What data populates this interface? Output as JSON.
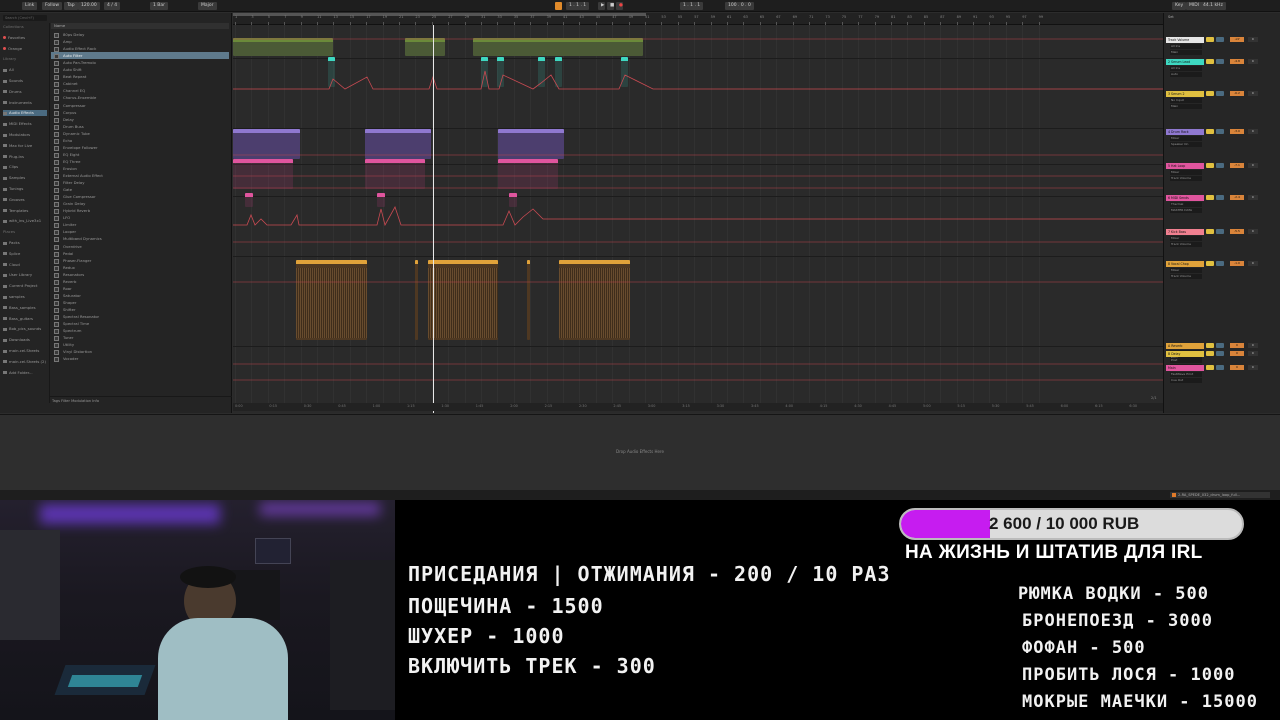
{
  "toolbar": {
    "link_label": "Link",
    "follow_label": "Follow",
    "tap_label": "Tap",
    "tempo": "120.00",
    "signature": "4 / 4",
    "quantize": "1 Bar",
    "key_label": "Major",
    "position": "1 . 1 . 1",
    "loop_length": "100 . 0 . 0",
    "cpu_label": "Key",
    "midi_label": "MIDI",
    "zoom": "44.1 kHz"
  },
  "browser": {
    "search_placeholder": "Search (Cmd+F)",
    "sections": [
      {
        "label": "Collections",
        "kind": "head"
      },
      {
        "label": "Favorites",
        "kind": "fav"
      },
      {
        "label": "Orange",
        "kind": "fav"
      },
      {
        "label": "Library",
        "kind": "head"
      },
      {
        "label": "All",
        "kind": "item"
      },
      {
        "label": "Sounds",
        "kind": "item"
      },
      {
        "label": "Drums",
        "kind": "item"
      },
      {
        "label": "Instruments",
        "kind": "item"
      },
      {
        "label": "Audio Effects",
        "kind": "active"
      },
      {
        "label": "MIDI Effects",
        "kind": "item"
      },
      {
        "label": "Modulators",
        "kind": "item"
      },
      {
        "label": "Max for Live",
        "kind": "item"
      },
      {
        "label": "Plug-Ins",
        "kind": "item"
      },
      {
        "label": "Clips",
        "kind": "item"
      },
      {
        "label": "Samples",
        "kind": "item"
      },
      {
        "label": "Tunings",
        "kind": "item"
      },
      {
        "label": "Grooves",
        "kind": "item"
      },
      {
        "label": "Templates",
        "kind": "item"
      },
      {
        "label": "with_ins_Live3x1",
        "kind": "item"
      },
      {
        "label": "Places",
        "kind": "head"
      },
      {
        "label": "Packs",
        "kind": "item"
      },
      {
        "label": "Splice",
        "kind": "item"
      },
      {
        "label": "Cloud",
        "kind": "item"
      },
      {
        "label": "User Library",
        "kind": "item"
      },
      {
        "label": "Current Project",
        "kind": "item"
      },
      {
        "label": "samples",
        "kind": "item"
      },
      {
        "label": "Bass_samples",
        "kind": "item"
      },
      {
        "label": "Bass_guitars",
        "kind": "item"
      },
      {
        "label": "Bob_pics_sounds",
        "kind": "item"
      },
      {
        "label": "Downloads",
        "kind": "item"
      },
      {
        "label": "main.cel.Sheets",
        "kind": "item"
      },
      {
        "label": "main.cel.Sheets (2)",
        "kind": "item"
      },
      {
        "label": "Add Folder...",
        "kind": "item"
      }
    ],
    "list_header": "Name",
    "items": [
      "80ps Delay",
      "Amp",
      "Audio Effect Rack",
      "Auto Filter",
      "Auto Pan-Tremolo",
      "Auto Shift",
      "Beat Repeat",
      "Cabinet",
      "Channel EQ",
      "Chorus-Ensemble",
      "Compressor",
      "Corpus",
      "Delay",
      "Drum Buss",
      "Dynamic Tube",
      "Echo",
      "Envelope Follower",
      "EQ Eight",
      "EQ Three",
      "Erosion",
      "External Audio Effect",
      "Filter Delay",
      "Gate",
      "Glue Compressor",
      "Grain Delay",
      "Hybrid Reverb",
      "LFO",
      "Limiter",
      "Looper",
      "Multiband Dynamics",
      "Overdrive",
      "Pedal",
      "Phaser-Flanger",
      "Redux",
      "Resonators",
      "Reverb",
      "Roar",
      "Saturator",
      "Shaper",
      "Shifter",
      "Spectral Resonator",
      "Spectral Time",
      "Spectrum",
      "Tuner",
      "Utility",
      "Vinyl Distortion",
      "Vocoder"
    ],
    "selected_index": 3,
    "footer": "Tags   Filter   Modulation   Info",
    "status": "1 item selected"
  },
  "arrangement": {
    "beats": [
      "1",
      "3",
      "5",
      "7",
      "9",
      "11",
      "13",
      "15",
      "17",
      "19",
      "21",
      "23",
      "25",
      "27",
      "29",
      "31",
      "33",
      "35",
      "37",
      "39",
      "41",
      "43",
      "45",
      "47",
      "49",
      "51",
      "53",
      "55",
      "57",
      "59",
      "61",
      "63",
      "65",
      "67",
      "69",
      "71",
      "73",
      "75",
      "77",
      "79",
      "81",
      "83",
      "85",
      "87",
      "89",
      "91",
      "93",
      "95",
      "97",
      "99"
    ],
    "times": [
      "0:00",
      "0:15",
      "0:30",
      "0:45",
      "1:00",
      "1:15",
      "1:30",
      "1:45",
      "2:00",
      "2:15",
      "2:30",
      "2:45",
      "3:00",
      "3:15",
      "3:30",
      "3:45",
      "4:00",
      "4:15",
      "4:30",
      "4:45",
      "5:00",
      "5:15",
      "5:30",
      "5:45",
      "6:00",
      "6:15",
      "6:30",
      "6:45"
    ],
    "page_indicator": "2/1"
  },
  "mixer": {
    "set_label": "Set",
    "tracks": [
      {
        "name": "Track Volume",
        "color": "#e6e6e6",
        "input": "All Ins",
        "monitor": "Main",
        "vol": "-inf"
      },
      {
        "name": "2 Serum Lead",
        "color": "#3ed8c1",
        "input": "All Ins",
        "monitor": "Auto",
        "vol": "-4.8"
      },
      {
        "name": "3 Serum 2",
        "color": "#e0c040",
        "input": "No Input",
        "monitor": "Main",
        "vol": "-6.2"
      },
      {
        "name": "4 Drum Rack",
        "color": "#8f78d0",
        "input": "Mixer",
        "monitor": "Speaker On",
        "vol": "-3.0"
      },
      {
        "name": "5 Hat Loop",
        "color": "#e0559e",
        "input": "Mixer",
        "monitor": "Track Volume",
        "vol": "-7.1"
      },
      {
        "name": "6 MIDI Sends",
        "color": "#e0559e",
        "input": "Thermal",
        "monitor": "MASTER DATA",
        "vol": "-2.4"
      },
      {
        "name": "7 Kick Bass",
        "color": "#f08090",
        "input": "Mixer",
        "monitor": "Track Volume",
        "vol": "-5.5"
      },
      {
        "name": "8 Vocal Chop",
        "color": "#e0a23a",
        "input": "Mixer",
        "monitor": "Track Volume",
        "vol": "-1.0"
      },
      {
        "name": "A Reverb",
        "color": "#e0a23a",
        "input": "Post",
        "monitor": "Main",
        "vol": "0"
      },
      {
        "name": "B Delay",
        "color": "#e0c040",
        "input": "Post",
        "monitor": "Main",
        "vol": "0"
      },
      {
        "name": "Main",
        "color": "#e0559e",
        "input": "FastWave Print",
        "monitor": "Cue Out",
        "vol": "0"
      }
    ]
  },
  "device": {
    "hint": "Drop Audio Effects Here",
    "bottom_file": "2-RA_SPEDE_032_drum_loop_full..."
  },
  "overlay": {
    "goal": {
      "text": "2 600 / 10 000 RUB",
      "current": 2600,
      "target": 10000,
      "fill_color": "#c61cf0",
      "subtitle": "НА ЖИЗНЬ И ШТАТИВ ДЛЯ IRL"
    },
    "left_list": [
      "ПРИСЕДАНИЯ | ОТЖИМАНИЯ - 200 / 10 РАЗ",
      "ПОЩЕЧИНА - 1500",
      "ШУХЕР - 1000",
      "ВКЛЮЧИТЬ ТРЕК - 300"
    ],
    "right_list": [
      "РЮМКА ВОДКИ - 500",
      "БРОНЕПОЕЗД - 3000",
      "ФОФАН - 500",
      "ПРОБИТЬ ЛОСЯ - 1000",
      "МОКРЫЕ МАЕЧКИ - 15000"
    ]
  }
}
